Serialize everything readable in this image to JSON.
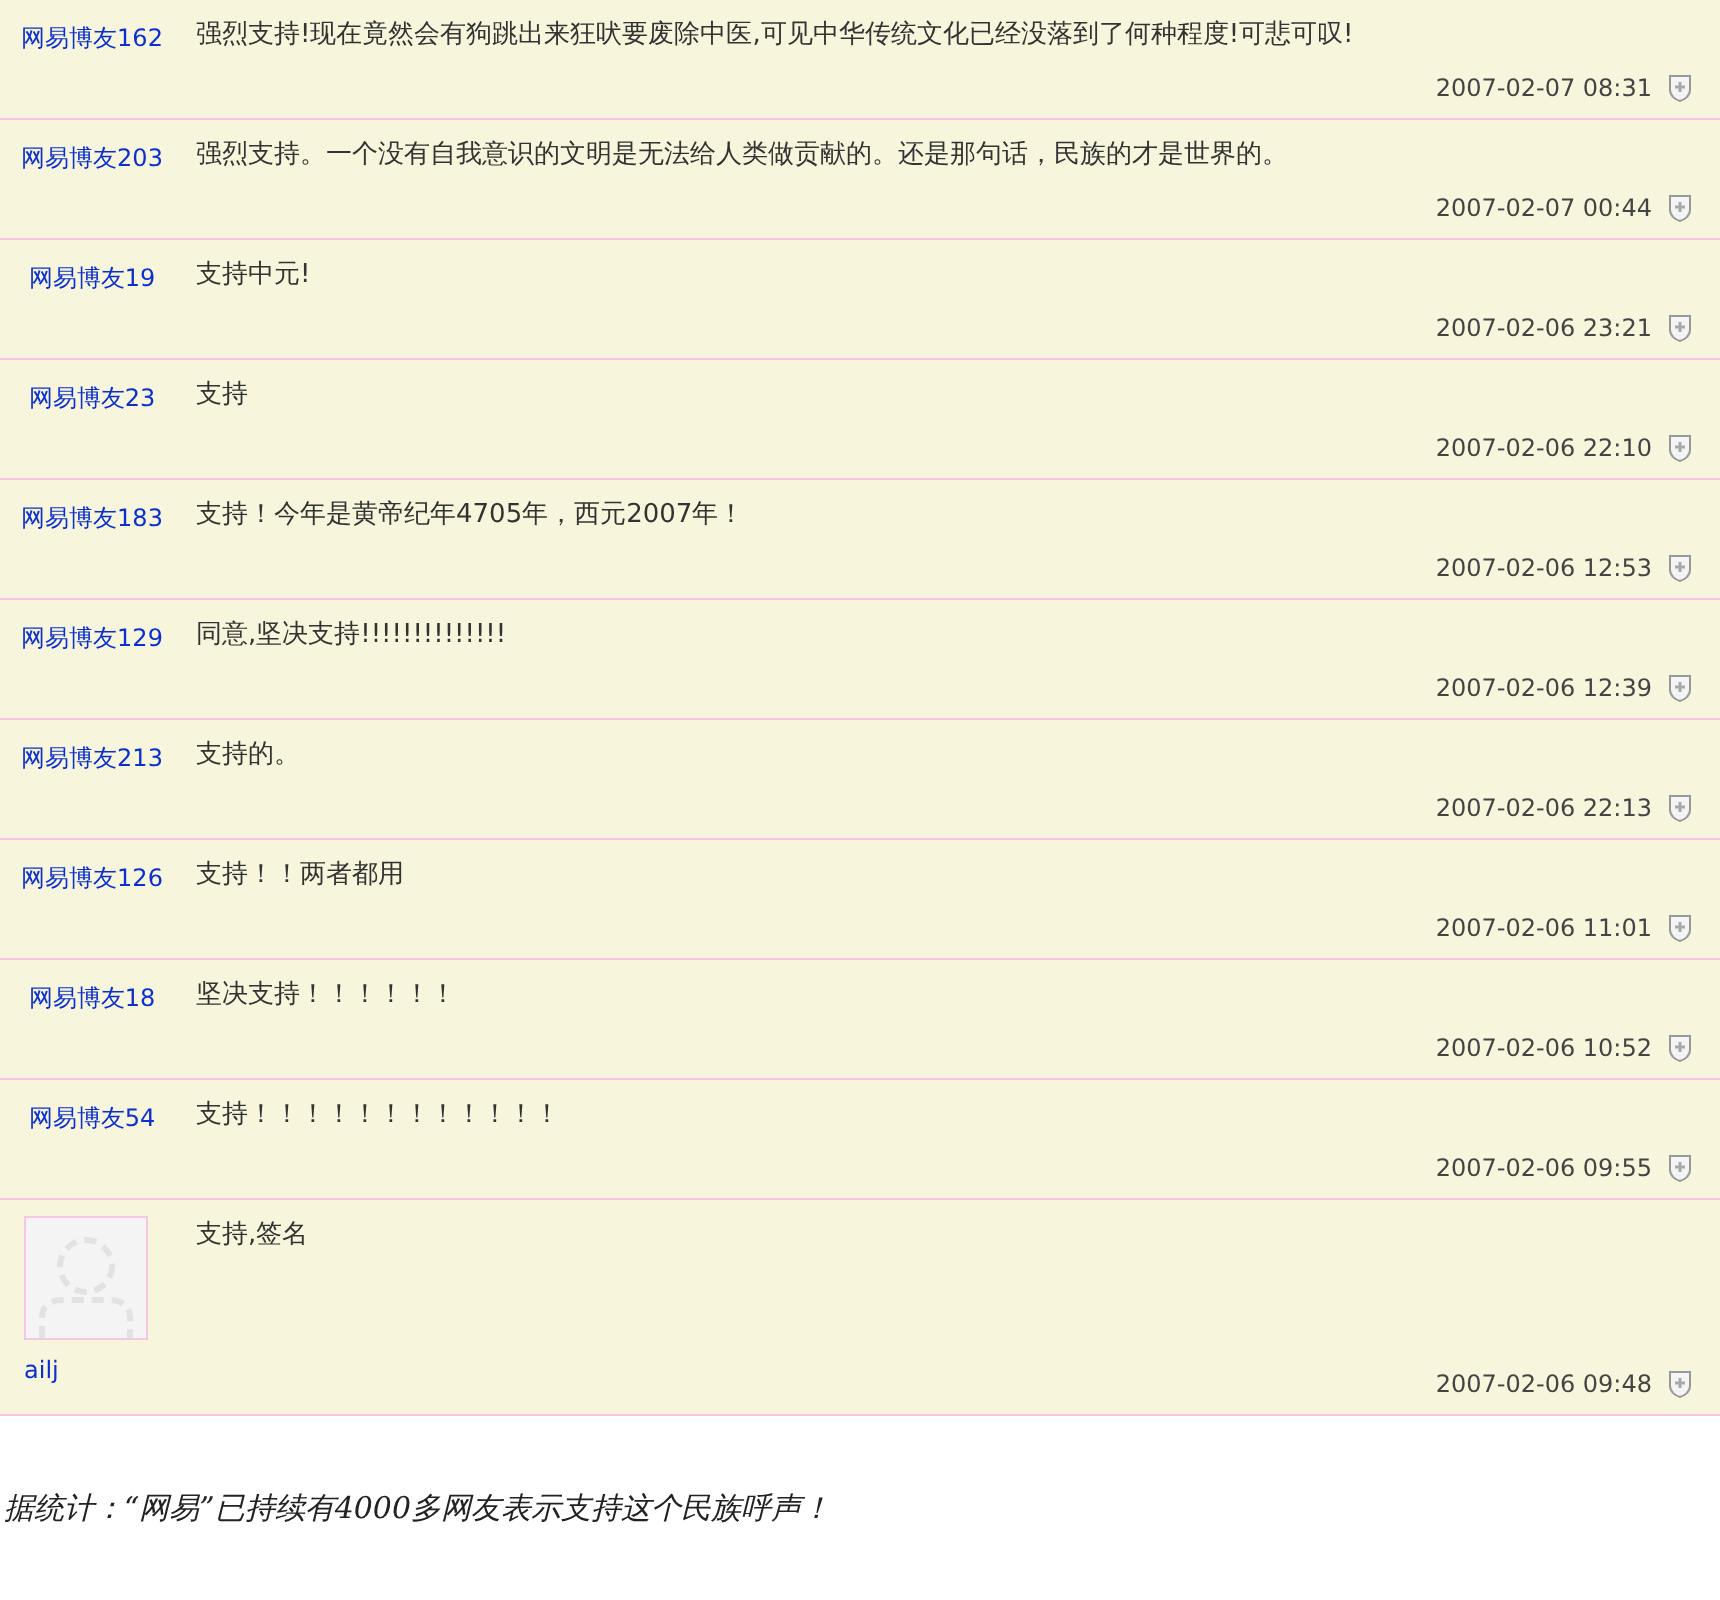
{
  "comments": [
    {
      "kind": "plain",
      "author": "网易博友162",
      "text": "强烈支持!现在竟然会有狗跳出来狂吠要废除中医,可见中华传统文化已经没落到了何种程度!可悲可叹!",
      "time": "2007-02-07 08:31"
    },
    {
      "kind": "plain",
      "author": "网易博友203",
      "text": "强烈支持。一个没有自我意识的文明是无法给人类做贡献的。还是那句话，民族的才是世界的。",
      "time": "2007-02-07 00:44"
    },
    {
      "kind": "plain",
      "author": "网易博友19",
      "text": "支持中元!",
      "time": "2007-02-06 23:21"
    },
    {
      "kind": "plain",
      "author": "网易博友23",
      "text": "支持",
      "time": "2007-02-06 22:10"
    },
    {
      "kind": "plain",
      "author": "网易博友183",
      "text": "支持！今年是黄帝纪年4705年，西元2007年！",
      "time": "2007-02-06 12:53"
    },
    {
      "kind": "plain",
      "author": "网易博友129",
      "text": "同意,坚决支持!!!!!!!!!!!!!!",
      "time": "2007-02-06 12:39"
    },
    {
      "kind": "plain",
      "author": "网易博友213",
      "text": "支持的。",
      "time": "2007-02-06 22:13"
    },
    {
      "kind": "plain",
      "author": "网易博友126",
      "text": "支持！！两者都用",
      "time": "2007-02-06 11:01"
    },
    {
      "kind": "plain",
      "author": "网易博友18",
      "text": "坚决支持！！！！！！",
      "time": "2007-02-06 10:52"
    },
    {
      "kind": "plain",
      "author": "网易博友54",
      "text": "支持！！！！！！！！！！！！",
      "time": "2007-02-06 09:55"
    },
    {
      "kind": "avatar",
      "author": "ailj",
      "text": "支持,签名",
      "time": "2007-02-06 09:48"
    }
  ],
  "footer": "据统计：“网易”已持续有4000多网友表示支持这个民族呼声！"
}
